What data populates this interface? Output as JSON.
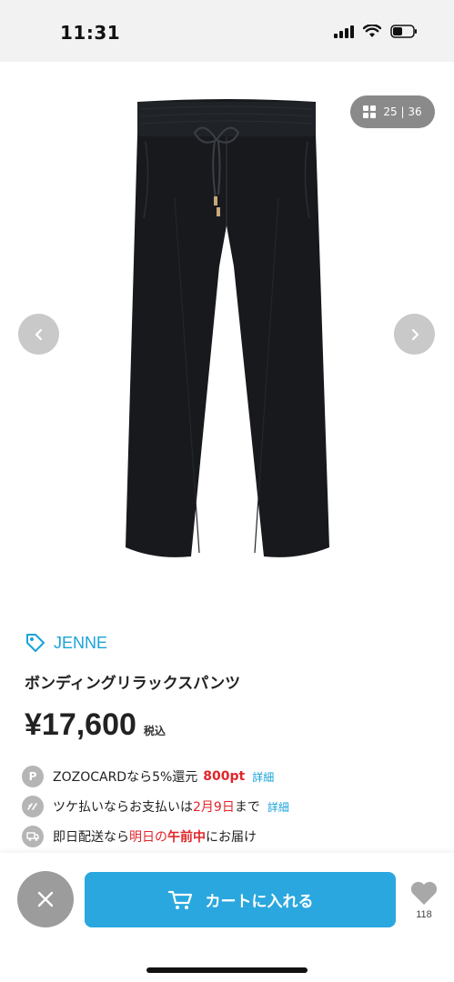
{
  "status_bar": {
    "time": "11:31"
  },
  "gallery": {
    "counter": "25 | 36",
    "prev_icon": "chevron-left-icon",
    "next_icon": "chevron-right-icon"
  },
  "product": {
    "brand": "JENNE",
    "name": "ボンディングリラックスパンツ",
    "price": "¥17,600",
    "tax_label": "税込"
  },
  "info": {
    "points": {
      "icon_label": "P",
      "text": "ZOZOCARDなら5%還元",
      "points": "800pt",
      "link": "詳細"
    },
    "deferred": {
      "text_before": "ツケ払いならお支払いは",
      "date": "2月9日",
      "text_after": "まで",
      "link": "詳細"
    },
    "delivery": {
      "text_before": "即日配送なら",
      "highlight_1": "明日の",
      "highlight_2": "午前中",
      "text_after": "にお届け"
    }
  },
  "actions": {
    "cart_label": "カートに入れる",
    "favorite_count": "118"
  },
  "colors": {
    "accent": "#2aa7de",
    "brand": "#1aa3d9",
    "highlight": "#e0252b",
    "icon_gray": "#b5b5b5"
  }
}
